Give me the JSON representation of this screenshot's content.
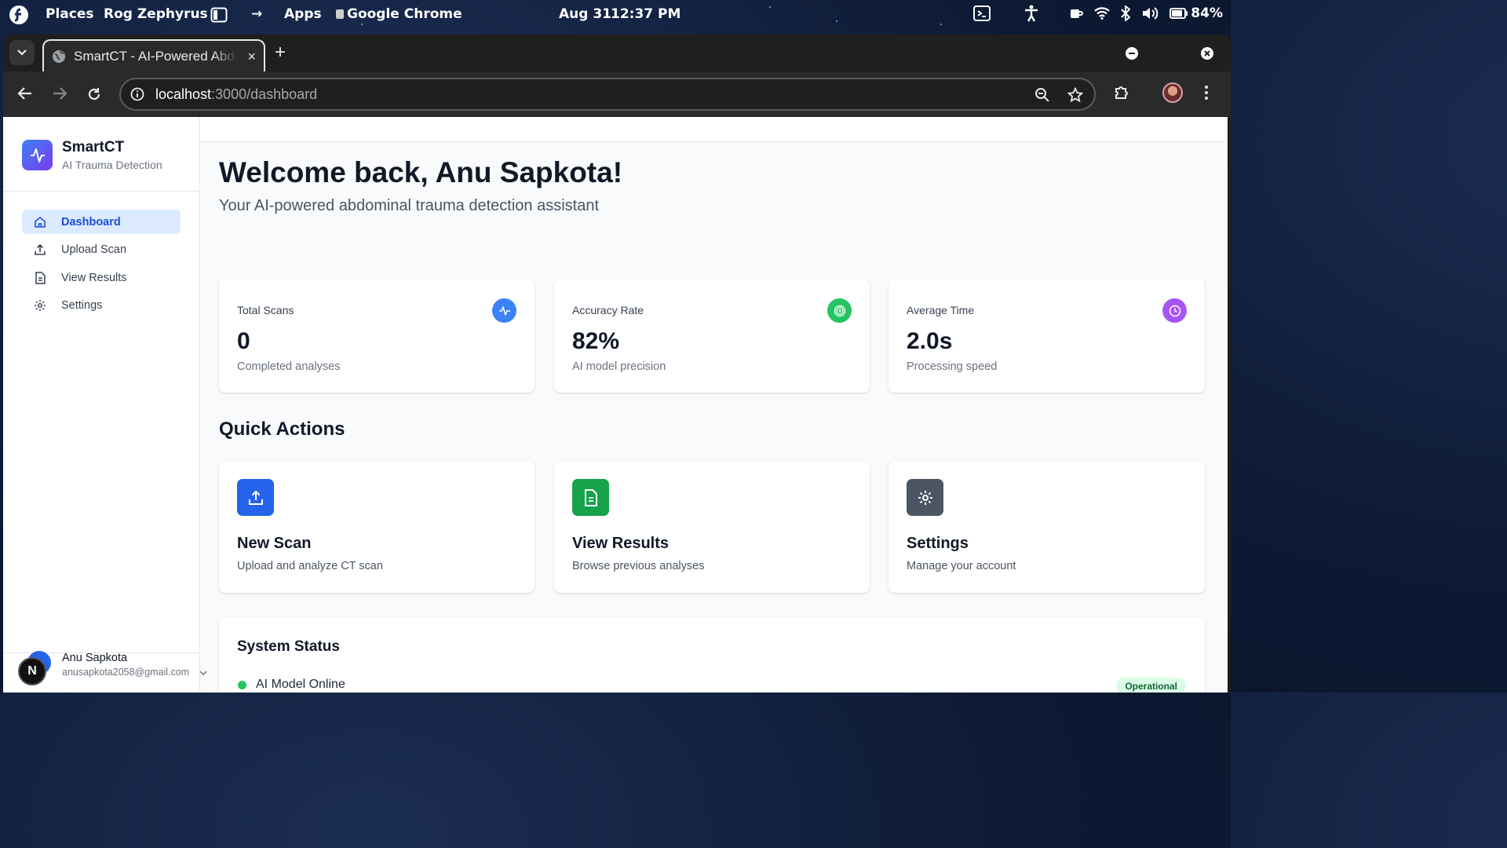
{
  "os_bar": {
    "places": "Places",
    "device": "Rog Zephyrus",
    "arrow": "→",
    "apps": "Apps",
    "active_app": "Google Chrome",
    "date": "Aug 31",
    "time": "12:37 PM",
    "battery": "84%"
  },
  "browser": {
    "tab_title": "SmartCT - AI-Powered Abdominal Trauma Detection",
    "tab_close": "×",
    "new_tab": "+",
    "url_host": "localhost",
    "url_path": ":3000/dashboard"
  },
  "sidebar": {
    "brand_name": "SmartCT",
    "brand_sub": "AI Trauma Detection",
    "items": [
      {
        "label": "Dashboard",
        "icon": "home-icon",
        "active": true
      },
      {
        "label": "Upload Scan",
        "icon": "upload-icon",
        "active": false
      },
      {
        "label": "View Results",
        "icon": "file-icon",
        "active": false
      },
      {
        "label": "Settings",
        "icon": "gear-icon",
        "active": false
      }
    ],
    "user": {
      "initial": "N",
      "name": "Anu Sapkota",
      "email": "anusapkota2058@gmail.com"
    }
  },
  "main": {
    "welcome": "Welcome back, Anu Sapkota!",
    "subtitle": "Your AI-powered abdominal trauma detection assistant",
    "stats": [
      {
        "label": "Total Scans",
        "value": "0",
        "sub": "Completed analyses",
        "icon": "activity-icon",
        "color": "#3b82f6"
      },
      {
        "label": "Accuracy Rate",
        "value": "82%",
        "sub": "AI model precision",
        "icon": "target-icon",
        "color": "#22c55e"
      },
      {
        "label": "Average Time",
        "value": "2.0s",
        "sub": "Processing speed",
        "icon": "clock-icon",
        "color": "#a855f7"
      }
    ],
    "quick_actions_title": "Quick Actions",
    "quick_actions": [
      {
        "title": "New Scan",
        "sub": "Upload and analyze CT scan",
        "icon": "upload-icon",
        "color": "#2563eb"
      },
      {
        "title": "View Results",
        "sub": "Browse previous analyses",
        "icon": "file-icon",
        "color": "#16a34a"
      },
      {
        "title": "Settings",
        "sub": "Manage your account",
        "icon": "gear-icon",
        "color": "#4b5563"
      }
    ],
    "system_status": {
      "title": "System Status",
      "label": "AI Model Online",
      "badge": "Operational"
    }
  }
}
